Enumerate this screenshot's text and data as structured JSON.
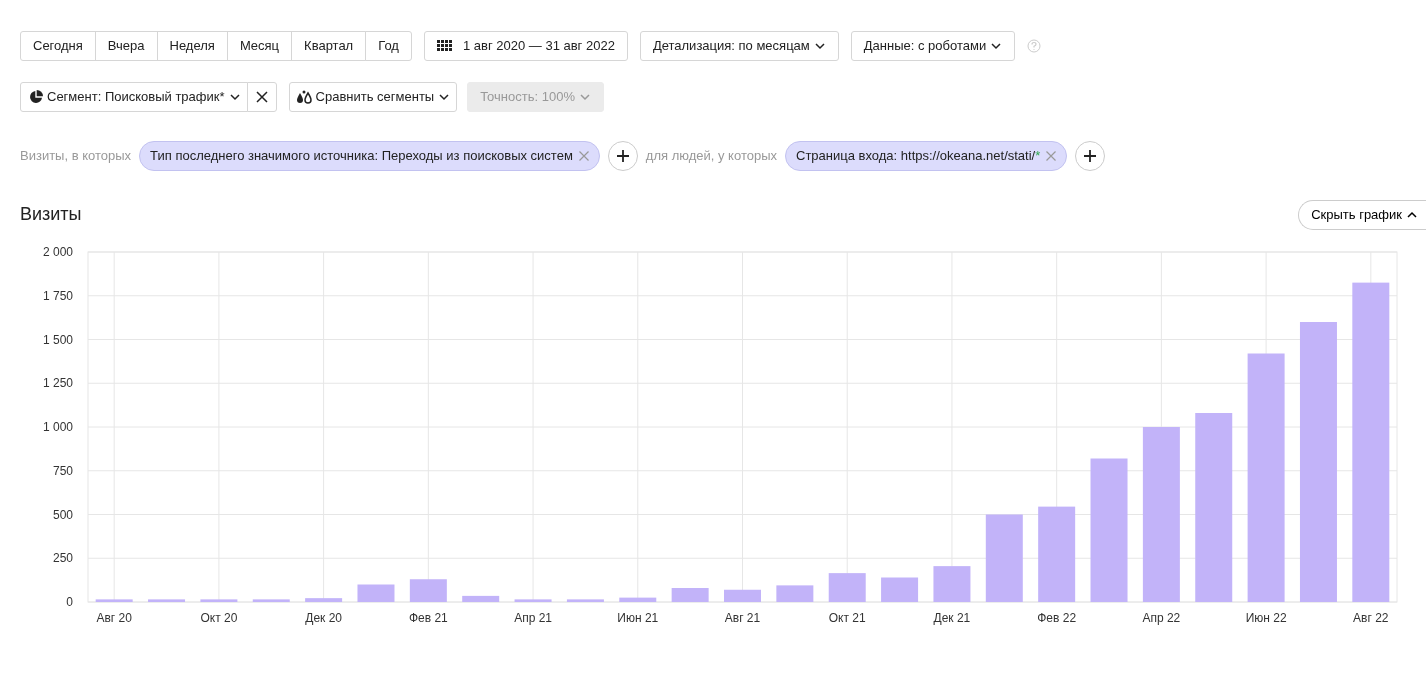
{
  "period_buttons": [
    {
      "label": "Сегодня",
      "selected": false
    },
    {
      "label": "Вчера",
      "selected": false
    },
    {
      "label": "Неделя",
      "selected": false
    },
    {
      "label": "Месяц",
      "selected": false
    },
    {
      "label": "Квартал",
      "selected": false
    },
    {
      "label": "Год",
      "selected": false
    }
  ],
  "date_range": "1 авг 2020 — 31 авг 2022",
  "dropdowns": [
    {
      "label": "Детализация: по месяцам"
    },
    {
      "label": "Данные: с роботами"
    }
  ],
  "segment": {
    "label": "Сегмент: Поисковый трафик*"
  },
  "compare": {
    "label": "Сравнить сегменты"
  },
  "accuracy": {
    "label": "Точность: 100%",
    "disabled": true
  },
  "filters": [
    {
      "kind": "text",
      "text": "Визиты, в которых"
    },
    {
      "kind": "chip",
      "text": "Тип последнего значимого источника: Переходы из поисковых систем"
    },
    {
      "kind": "add"
    },
    {
      "kind": "text",
      "text": "для людей, у которых"
    },
    {
      "kind": "chip",
      "text": "Страница входа: https://okeana.net/stati/",
      "mark": "*"
    },
    {
      "kind": "add"
    }
  ],
  "report": {
    "title": "Визиты",
    "toggle": "Скрыть график",
    "chart_data": {
      "type": "bar",
      "categories": [
        "Авг 20",
        null,
        "Окт 20",
        null,
        "Дек 20",
        null,
        "Фев 21",
        null,
        "Апр 21",
        null,
        "Июн 21",
        null,
        "Авг 21",
        null,
        "Окт 21",
        null,
        "Дек 21",
        null,
        "Фев 22",
        null,
        "Апр 22",
        null,
        "Июн 22",
        null,
        "Авг 22"
      ],
      "series": [
        {
          "color": "#c2b3f9",
          "values": [
            15,
            15,
            15,
            15,
            22,
            100,
            130,
            35,
            15,
            15,
            25,
            80,
            70,
            95,
            165,
            140,
            205,
            500,
            545,
            820,
            1000,
            1080,
            1420,
            1600,
            1825
          ]
        }
      ],
      "ylim": [
        0,
        2000
      ],
      "grid": true,
      "yticks": [
        {
          "value": 0,
          "label": "0"
        },
        {
          "value": 250,
          "label": "250"
        },
        {
          "value": 500,
          "label": "500"
        },
        {
          "value": 750,
          "label": "750"
        },
        {
          "value": 1000,
          "label": "1 000"
        },
        {
          "value": 1250,
          "label": "1 250"
        },
        {
          "value": 1500,
          "label": "1 500"
        },
        {
          "value": 1750,
          "label": "1 750"
        },
        {
          "value": 2000,
          "label": "2 000"
        }
      ]
    }
  }
}
